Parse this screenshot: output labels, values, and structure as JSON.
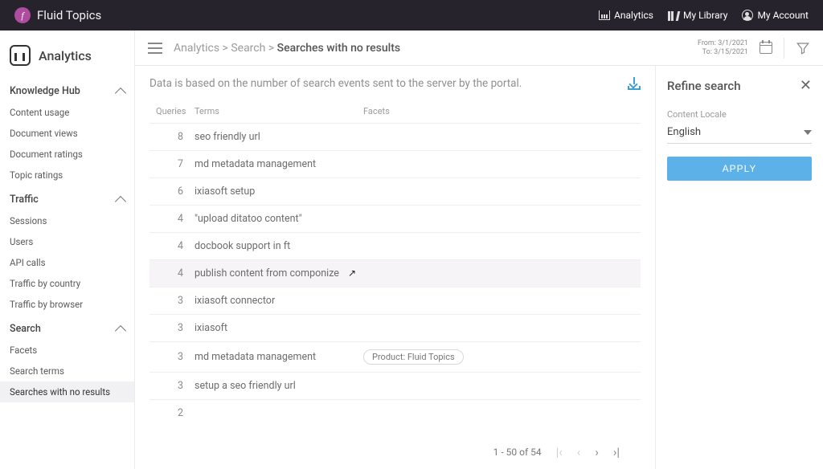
{
  "brand": {
    "name": "Fluid Topics"
  },
  "topbar": {
    "analytics": "Analytics",
    "library": "My Library",
    "account": "My Account"
  },
  "sidebar": {
    "title": "Analytics",
    "sections": [
      {
        "title": "Knowledge Hub",
        "items": [
          "Content usage",
          "Document views",
          "Document ratings",
          "Topic ratings"
        ]
      },
      {
        "title": "Traffic",
        "items": [
          "Sessions",
          "Users",
          "API calls",
          "Traffic by country",
          "Traffic by browser"
        ]
      },
      {
        "title": "Search",
        "items": [
          "Facets",
          "Search terms",
          "Searches with no results"
        ]
      }
    ]
  },
  "breadcrumb": {
    "a": "Analytics",
    "b": "Search",
    "current": "Searches with no results"
  },
  "date": {
    "from_label": "From:",
    "from": "3/1/2021",
    "to_label": "To:",
    "to": "3/15/2021"
  },
  "content": {
    "description": "Data is based on the number of search events sent to the server by the portal.",
    "columns": {
      "queries": "Queries",
      "terms": "Terms",
      "facets": "Facets"
    },
    "rows": [
      {
        "q": "8",
        "t": "seo friendly url",
        "f": ""
      },
      {
        "q": "7",
        "t": "md metadata management",
        "f": ""
      },
      {
        "q": "6",
        "t": "ixiasoft setup",
        "f": ""
      },
      {
        "q": "4",
        "t": "\"upload ditatoo content\"",
        "f": ""
      },
      {
        "q": "4",
        "t": "docbook support in ft",
        "f": ""
      },
      {
        "q": "4",
        "t": "publish content from componize",
        "f": "",
        "hover": true,
        "cursor": true
      },
      {
        "q": "3",
        "t": "ixiasoft connector",
        "f": ""
      },
      {
        "q": "3",
        "t": "ixiasoft",
        "f": ""
      },
      {
        "q": "3",
        "t": "md metadata management",
        "f": "Product: Fluid Topics"
      },
      {
        "q": "3",
        "t": "setup a seo friendly url",
        "f": ""
      },
      {
        "q": "2",
        "t": "",
        "f": ""
      }
    ],
    "pager": "1 - 50 of 54"
  },
  "refine": {
    "title": "Refine search",
    "locale_label": "Content Locale",
    "locale_value": "English",
    "apply": "APPLY"
  }
}
